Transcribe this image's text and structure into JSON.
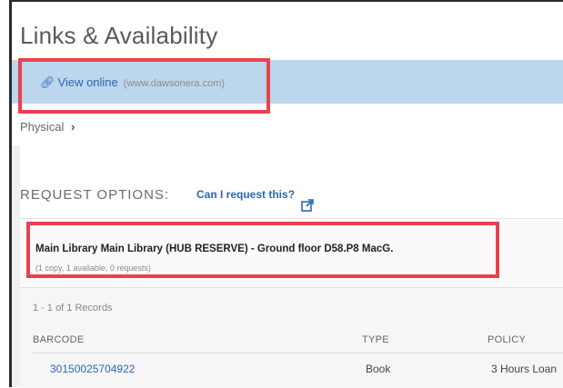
{
  "section": {
    "title": "Links & Availability"
  },
  "online": {
    "link_label": "View online",
    "source": "(www.dawsonera.com)"
  },
  "physical": {
    "label": "Physical",
    "chevron": "›"
  },
  "request": {
    "label": "REQUEST OPTIONS:",
    "link_label": "Can I request this?"
  },
  "holding": {
    "title": "Main Library  Main Library (HUB RESERVE) - Ground floor  D58.P8 MacG.",
    "summary": "(1 copy, 1 available, 0 requests)"
  },
  "records": {
    "count": "1 - 1 of 1 Records",
    "columns": [
      "BARCODE",
      "TYPE",
      "POLICY"
    ],
    "rows": [
      {
        "barcode": "30150025704922",
        "type": "Book",
        "policy": "3 Hours Loan"
      }
    ]
  },
  "colors": {
    "link_blue": "#2b66b3",
    "highlight_bar": "#bcd6ee",
    "annotation_red": "#e8424d"
  }
}
